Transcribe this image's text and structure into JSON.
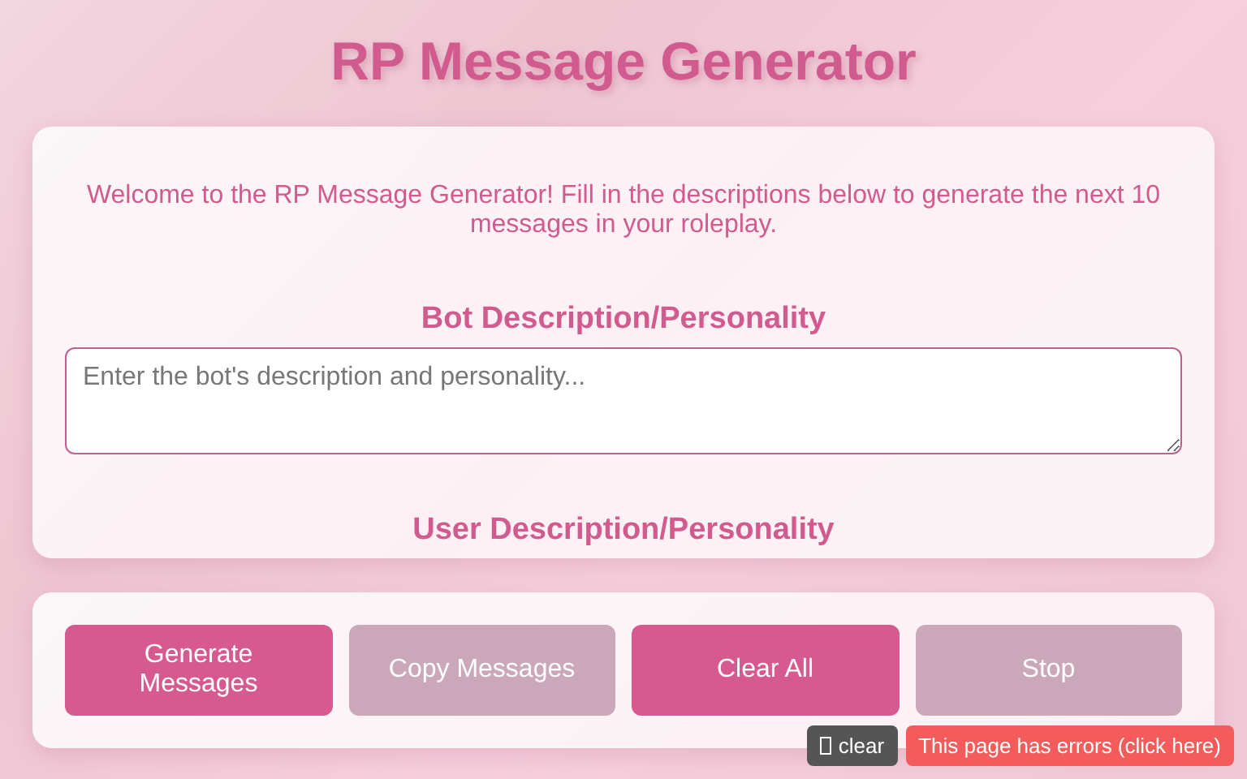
{
  "title": "RP Message Generator",
  "intro": "Welcome to the RP Message Generator! Fill in the descriptions below to generate the next 10 messages in your roleplay.",
  "sections": [
    {
      "heading": "Bot Description/Personality",
      "placeholder": "Enter the bot's description and personality..."
    },
    {
      "heading": "User Description/Personality"
    }
  ],
  "buttons": [
    {
      "label": "Generate Messages",
      "disabled": false
    },
    {
      "label": "Copy Messages",
      "disabled": true
    },
    {
      "label": "Clear All",
      "disabled": false
    },
    {
      "label": "Stop",
      "disabled": true
    }
  ],
  "overlay": {
    "clear_label": "clear",
    "error_label": "This page has errors (click here)"
  }
}
